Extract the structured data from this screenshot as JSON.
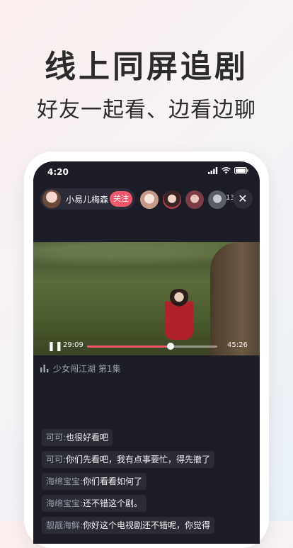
{
  "promo": {
    "headline": "线上同屏追剧",
    "subheadline": "好友一起看、边看边聊"
  },
  "status_bar": {
    "time": "4:20"
  },
  "room": {
    "host_name": "小易儿梅森",
    "follow_label": "关注",
    "viewer_count": "134",
    "close_glyph": "✕"
  },
  "player": {
    "current_time": "29:09",
    "total_time": "45:26",
    "progress": 0.64,
    "play_glyph": "❚❚"
  },
  "episode": {
    "title": "少女闯江湖 第1集"
  },
  "chat": [
    {
      "name": "可可:",
      "text": "也很好看吧"
    },
    {
      "name": "可可:",
      "text": "你们先看吧，我有点事要忙，得先撤了"
    },
    {
      "name": "海绵宝宝:",
      "text": "你们看看如何了"
    },
    {
      "name": "海绵宝宝:",
      "text": "还不错这个剧。"
    },
    {
      "name": "靓靓海鲜:",
      "text": "你好这个电视剧还不错呢，你觉得"
    }
  ],
  "colors": {
    "accent": "#f2566b",
    "screen_bg": "#1c1d26"
  }
}
